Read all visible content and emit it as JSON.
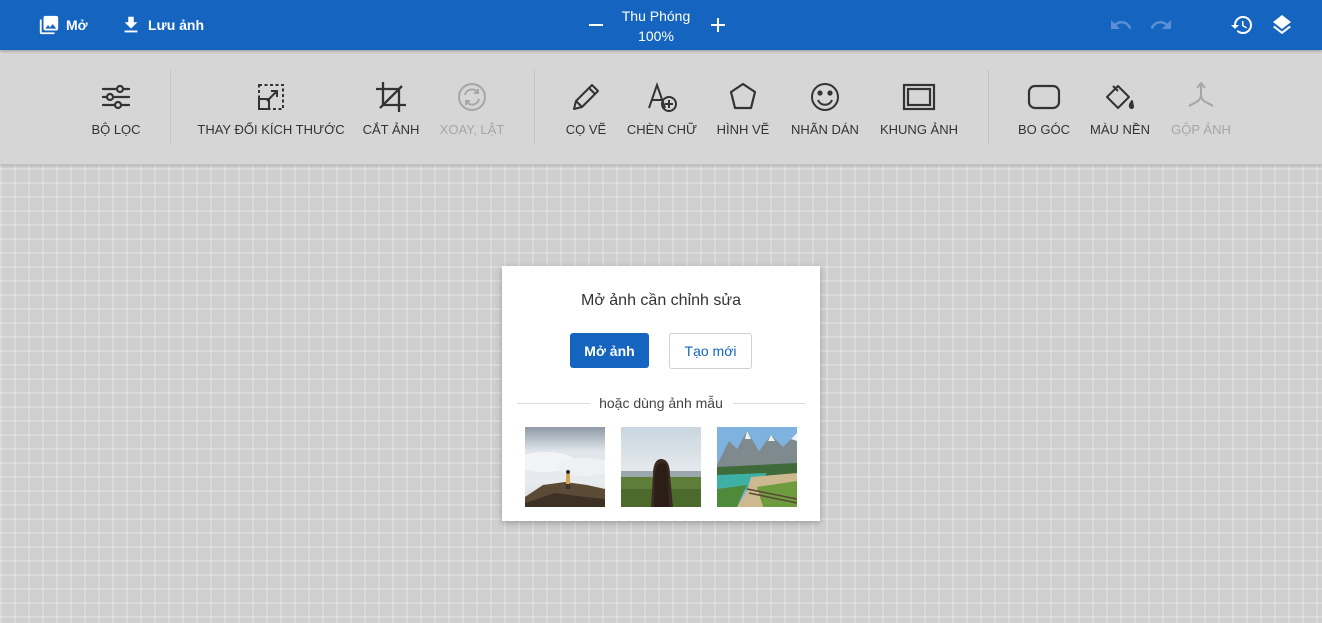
{
  "topbar": {
    "open_label": "Mở",
    "save_label": "Lưu ảnh",
    "zoom_label": "Thu Phóng",
    "zoom_value": "100%",
    "open_icon": "image-icon",
    "save_icon": "download-icon",
    "undo_icon": "undo-icon",
    "redo_icon": "redo-icon",
    "history_icon": "history-icon",
    "layers_icon": "layers-icon"
  },
  "toolbar": {
    "tools": [
      {
        "label": "BỘ LỌC",
        "icon": "sliders-icon",
        "enabled": true
      },
      {
        "label": "THAY ĐỔI KÍCH THƯỚC",
        "icon": "resize-icon",
        "enabled": true
      },
      {
        "label": "CẮT ẢNH",
        "icon": "crop-icon",
        "enabled": true
      },
      {
        "label": "XOAY, LẬT",
        "icon": "rotate-icon",
        "enabled": false
      },
      {
        "label": "CỌ VẼ",
        "icon": "pencil-icon",
        "enabled": true
      },
      {
        "label": "CHÈN CHỮ",
        "icon": "add-text-icon",
        "enabled": true
      },
      {
        "label": "HÌNH VẼ",
        "icon": "shape-icon",
        "enabled": true
      },
      {
        "label": "NHÃN DÁN",
        "icon": "smiley-icon",
        "enabled": true
      },
      {
        "label": "KHUNG ẢNH",
        "icon": "frame-icon",
        "enabled": true
      },
      {
        "label": "BO GÓC",
        "icon": "rounded-corner-icon",
        "enabled": true
      },
      {
        "label": "MÀU NỀN",
        "icon": "paint-bucket-icon",
        "enabled": true
      },
      {
        "label": "GỘP ẢNH",
        "icon": "merge-icon",
        "enabled": false
      }
    ]
  },
  "dialog": {
    "title": "Mở ảnh cần chỉnh sửa",
    "open_button": "Mở ảnh",
    "new_button": "Tạo mới",
    "or_text": "hoặc dùng ảnh mẫu"
  },
  "colors": {
    "primary": "#1565c0",
    "toolbar_bg": "#d6d6d6",
    "canvas_bg": "#cfcfcf",
    "disabled": "#a6a6a6"
  }
}
